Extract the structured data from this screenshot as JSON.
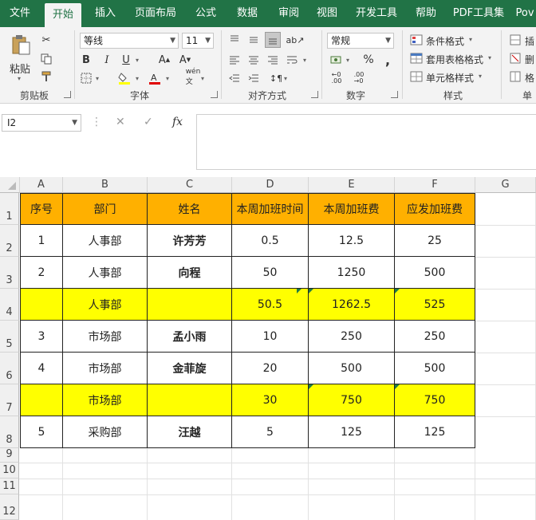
{
  "tabs": [
    "文件",
    "开始",
    "插入",
    "页面布局",
    "公式",
    "数据",
    "审阅",
    "视图",
    "开发工具",
    "帮助",
    "PDF工具集",
    "Pov"
  ],
  "clipboard": {
    "paste_label": "粘贴",
    "group_label": "剪贴板"
  },
  "font": {
    "name": "等线",
    "size": "11",
    "group_label": "字体"
  },
  "alignment": {
    "group_label": "对齐方式"
  },
  "number": {
    "format": "常规",
    "group_label": "数字",
    "percent": "%",
    "comma": ","
  },
  "styles": {
    "conditional": "条件格式",
    "table": "套用表格格式",
    "cell": "单元格样式",
    "group_label": "样式"
  },
  "cells_group": {
    "label": "单"
  },
  "namebox": "I2",
  "columns": [
    "A",
    "B",
    "C",
    "D",
    "E",
    "F",
    "G"
  ],
  "rows": [
    "1",
    "2",
    "3",
    "4",
    "5",
    "6",
    "7",
    "8",
    "9",
    "10",
    "11",
    "12"
  ],
  "table": {
    "header": [
      "序号",
      "部门",
      "姓名",
      "本周加班时间",
      "本周加班费",
      "应发加班费"
    ],
    "rows": [
      [
        "1",
        "人事部",
        "许芳芳",
        "0.5",
        "12.5",
        "25"
      ],
      [
        "2",
        "人事部",
        "向程",
        "50",
        "1250",
        "500"
      ],
      [
        "",
        "人事部",
        "",
        "50.5",
        "1262.5",
        "525"
      ],
      [
        "3",
        "市场部",
        "孟小雨",
        "10",
        "250",
        "250"
      ],
      [
        "4",
        "市场部",
        "金菲旋",
        "20",
        "500",
        "500"
      ],
      [
        "",
        "市场部",
        "",
        "30",
        "750",
        "750"
      ],
      [
        "5",
        "采购部",
        "汪越",
        "5",
        "125",
        "125"
      ]
    ]
  },
  "colors": {
    "ribbon": "#217346",
    "header_fill": "#ffb000",
    "subtotal_fill": "#ffff00"
  }
}
